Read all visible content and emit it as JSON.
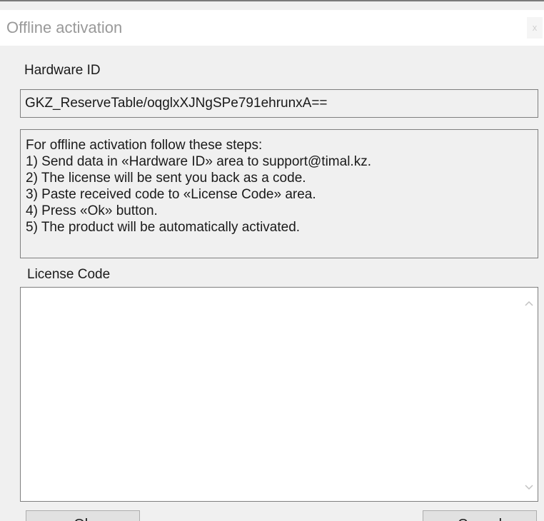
{
  "window": {
    "title": "Offline activation",
    "close_label": "x"
  },
  "hardware_id": {
    "label": "Hardware ID",
    "value": "GKZ_ReserveTable/oqglxXJNgSPe791ehrunxA=="
  },
  "instructions": {
    "lines": [
      "For offline activation follow these steps:",
      "1) Send data in «Hardware ID» area to support@timal.kz.",
      "2) The license will be sent you back as a code.",
      "3) Paste received code to «License Code» area.",
      "4) Press «Ok» button.",
      "5) The product will be automatically activated."
    ]
  },
  "license_code": {
    "label": "License Code",
    "value": ""
  },
  "buttons": {
    "ok_label": "Ok",
    "cancel_label": "Cancel"
  }
}
